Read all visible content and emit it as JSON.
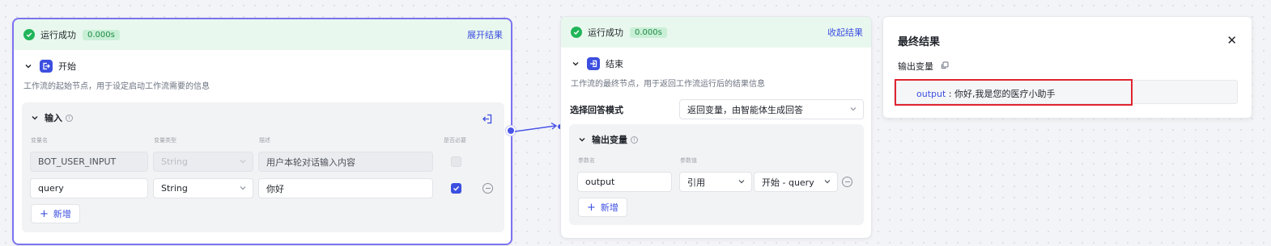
{
  "start_node": {
    "status_text": "运行成功",
    "time": "0.000s",
    "toggle_label": "展开结果",
    "title": "开始",
    "description": "工作流的起始节点，用于设定启动工作流需要的信息",
    "input_panel": {
      "title": "输入",
      "columns": [
        "变量名",
        "变量类型",
        "描述",
        "是否必要"
      ],
      "rows": [
        {
          "name": "BOT_USER_INPUT",
          "type": "String",
          "description": "用户本轮对话输入内容",
          "required": false,
          "locked": true
        },
        {
          "name": "query",
          "type": "String",
          "description": "你好",
          "required": true,
          "locked": false
        }
      ],
      "add_label": "新增"
    }
  },
  "end_node": {
    "status_text": "运行成功",
    "time": "0.000s",
    "toggle_label": "收起结果",
    "title": "结束",
    "description": "工作流的最终节点，用于返回工作流运行后的结果信息",
    "answer_mode_label": "选择回答模式",
    "answer_mode_value": "返回变量，由智能体生成回答",
    "output_panel": {
      "title": "输出变量",
      "columns": [
        "参数名",
        "参数值"
      ],
      "rows": [
        {
          "name": "output",
          "source": "引用",
          "value": "开始 - query"
        }
      ],
      "add_label": "新增"
    }
  },
  "result_panel": {
    "title": "最终结果",
    "close": "✕",
    "output_label": "输出变量",
    "output_key": "output",
    "output_separator": " : ",
    "output_value": "你好,我是您的医疗小助手"
  },
  "colors": {
    "accent": "#3d4fe0",
    "success": "#21b55a",
    "selected_border": "#7b73f0",
    "highlight": "#e0242f"
  }
}
